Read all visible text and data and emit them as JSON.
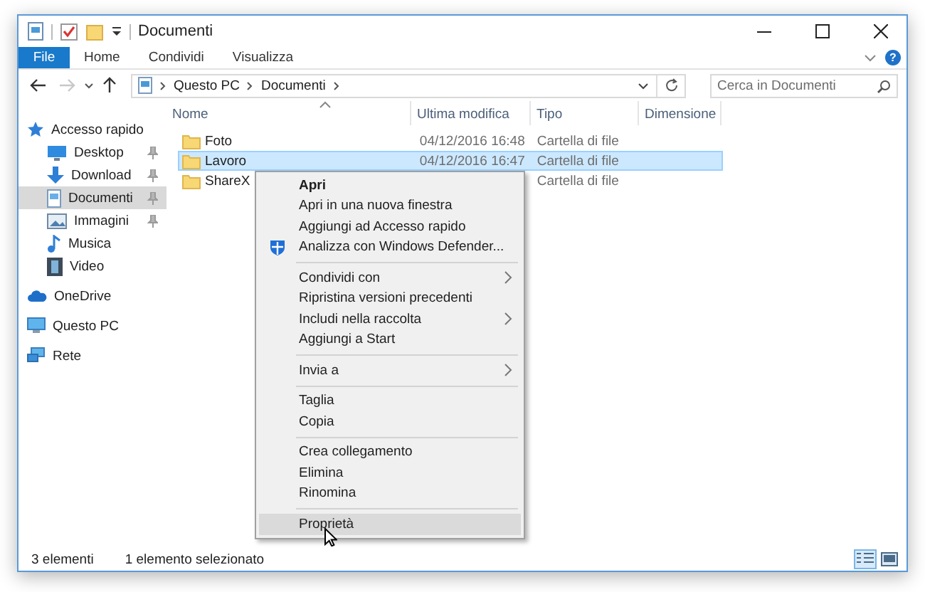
{
  "window": {
    "title": "Documenti"
  },
  "ribbon": {
    "tabs": [
      {
        "label": "File",
        "kind": "file",
        "selected": false
      },
      {
        "label": "Home",
        "kind": "tab",
        "selected": false
      },
      {
        "label": "Condividi",
        "kind": "tab",
        "selected": false
      },
      {
        "label": "Visualizza",
        "kind": "tab",
        "selected": false
      }
    ],
    "help": "?"
  },
  "address_bar": {
    "path": [
      "Questo PC",
      "Documenti"
    ]
  },
  "search": {
    "placeholder": "Cerca in Documenti"
  },
  "sidebar": {
    "items": [
      {
        "label": "Accesso rapido",
        "kind": "star",
        "selected": false,
        "children": [
          {
            "label": "Desktop",
            "kind": "desktop",
            "pinned": true,
            "selected": false
          },
          {
            "label": "Download",
            "kind": "download",
            "pinned": true,
            "selected": false
          },
          {
            "label": "Documenti",
            "kind": "document",
            "pinned": true,
            "selected": true
          },
          {
            "label": "Immagini",
            "kind": "image",
            "pinned": true,
            "selected": false
          },
          {
            "label": "Musica",
            "kind": "music",
            "pinned": false,
            "selected": false
          },
          {
            "label": "Video",
            "kind": "film",
            "pinned": false,
            "selected": false
          }
        ]
      },
      {
        "label": "OneDrive",
        "kind": "cloud",
        "selected": false
      },
      {
        "label": "Questo PC",
        "kind": "computer",
        "selected": false
      },
      {
        "label": "Rete",
        "kind": "network",
        "selected": false
      }
    ]
  },
  "file_list": {
    "columns": [
      "Nome",
      "Ultima modifica",
      "Tipo",
      "Dimensione"
    ],
    "rows": [
      {
        "name": "Foto",
        "modified": "04/12/2016 16:48",
        "type": "Cartella di file",
        "selected": false
      },
      {
        "name": "Lavoro",
        "modified": "04/12/2016 16:47",
        "type": "Cartella di file",
        "selected": true
      },
      {
        "name": "ShareX",
        "type": "Cartella di file",
        "selected": false
      }
    ]
  },
  "context_menu": {
    "groups": [
      [
        {
          "label": "Apri",
          "default": true,
          "submenu": false,
          "selected": false
        },
        {
          "label": "Apri in una nuova finestra",
          "default": false,
          "submenu": false,
          "selected": false
        },
        {
          "label": "Aggiungi ad Accesso rapido",
          "default": false,
          "submenu": false,
          "selected": false
        },
        {
          "label": "Analizza con Windows Defender...",
          "default": false,
          "submenu": false,
          "selected": false,
          "kind": "shield"
        }
      ],
      [
        {
          "label": "Condividi con",
          "default": false,
          "submenu": true,
          "selected": false
        },
        {
          "label": "Ripristina versioni precedenti",
          "default": false,
          "submenu": false,
          "selected": false
        },
        {
          "label": "Includi nella raccolta",
          "default": false,
          "submenu": true,
          "selected": false
        },
        {
          "label": "Aggiungi a Start",
          "default": false,
          "submenu": false,
          "selected": false
        }
      ],
      [
        {
          "label": "Invia a",
          "default": false,
          "submenu": true,
          "selected": false
        }
      ],
      [
        {
          "label": "Taglia",
          "default": false,
          "submenu": false,
          "selected": false
        },
        {
          "label": "Copia",
          "default": false,
          "submenu": false,
          "selected": false
        }
      ],
      [
        {
          "label": "Crea collegamento",
          "default": false,
          "submenu": false,
          "selected": false
        },
        {
          "label": "Elimina",
          "default": false,
          "submenu": false,
          "selected": false
        },
        {
          "label": "Rinomina",
          "default": false,
          "submenu": false,
          "selected": false
        }
      ],
      [
        {
          "label": "Proprietà",
          "default": false,
          "submenu": false,
          "selected": true
        }
      ]
    ]
  },
  "status_bar": {
    "items_count": "3 elementi",
    "selection": "1 elemento selezionato",
    "views": [
      {
        "kind": "details",
        "selected": true
      },
      {
        "kind": "large",
        "selected": false
      }
    ]
  }
}
